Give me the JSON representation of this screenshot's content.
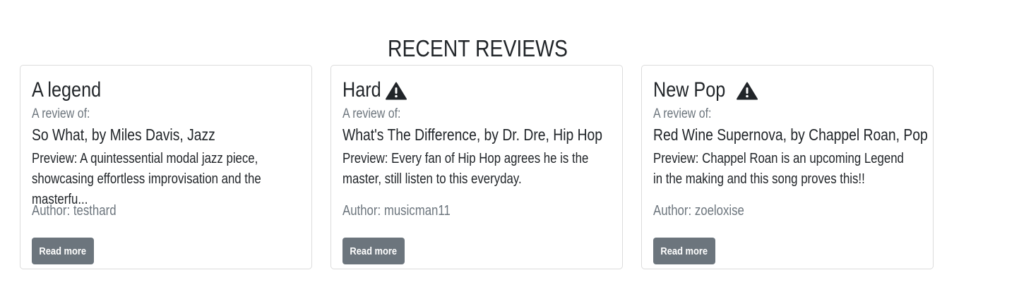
{
  "section": {
    "title": "RECENT REVIEWS"
  },
  "reviews": [
    {
      "title": "A legend",
      "warning": false,
      "review_of_label": "A review of:",
      "song_line": "So What, by Miles Davis, Jazz",
      "preview": "Preview: A quintessential modal jazz piece, showcasing effortless improvisation and the masterfu...",
      "author": "Author: testhard",
      "button_label": "Read more"
    },
    {
      "title": "Hard",
      "warning": true,
      "review_of_label": "A review of:",
      "song_line": "What's The Difference, by Dr. Dre, Hip Hop",
      "preview": "Preview: Every fan of Hip Hop agrees he is the master, still listen to this everyday.",
      "author": "Author: musicman11",
      "button_label": "Read more"
    },
    {
      "title": "New Pop",
      "warning": true,
      "review_of_label": "A review of:",
      "song_line": "Red Wine Supernova, by Chappel Roan, Pop",
      "preview": "Preview: Chappel Roan is an upcoming Legend in the making and this song proves this!!",
      "author": "Author: zoeloxise",
      "button_label": "Read more"
    }
  ],
  "icons": {
    "warning": "warning-triangle-icon"
  },
  "colors": {
    "button_bg": "#6c757d",
    "muted_text": "#6c757d",
    "body_text": "#212529",
    "card_border": "#dcdcdc"
  }
}
